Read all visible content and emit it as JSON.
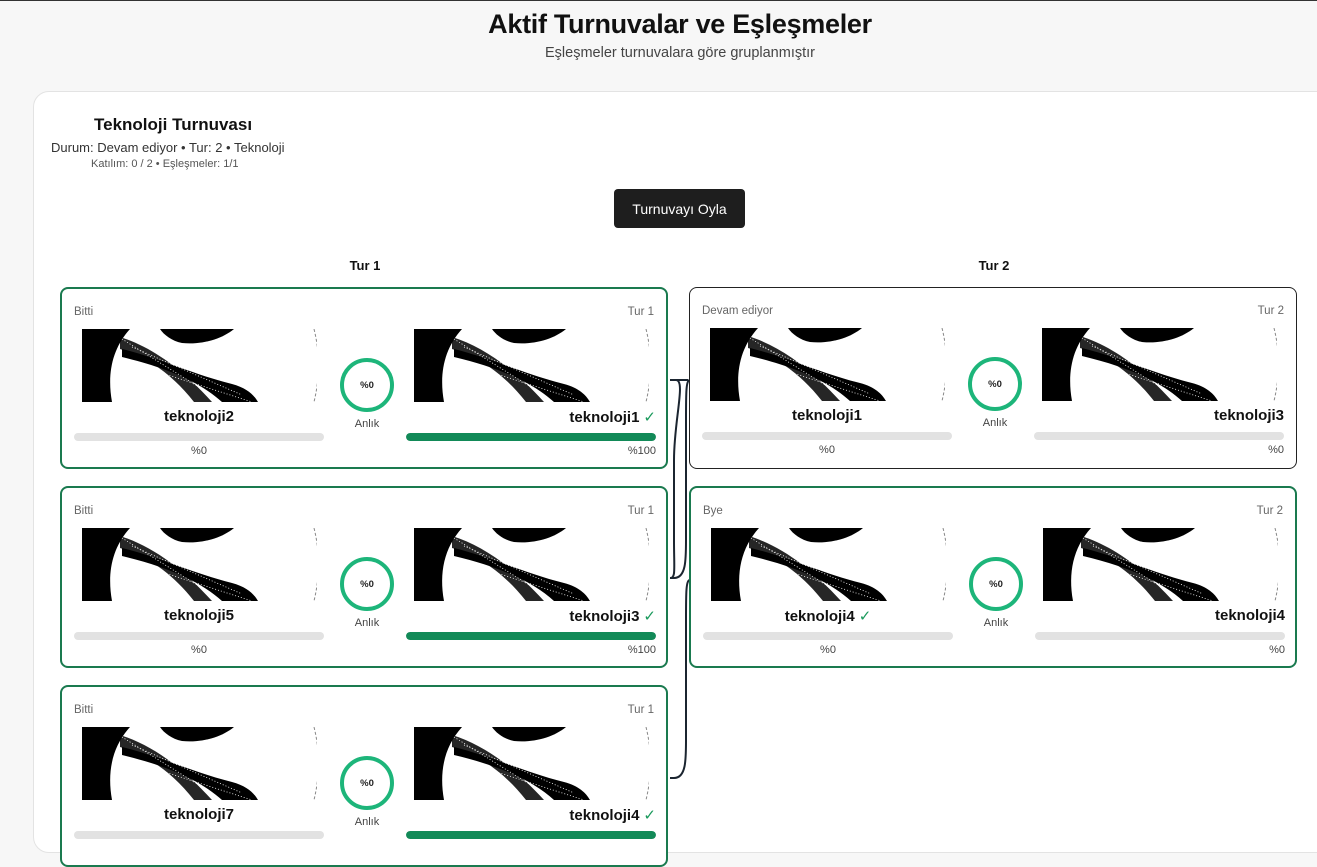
{
  "header": {
    "title": "Aktif Turnuvalar ve Eşleşmeler",
    "subtitle": "Eşleşmeler turnuvalara göre gruplanmıştır"
  },
  "tournament": {
    "name": "Teknoloji Turnuvası",
    "meta": "Durum: Devam ediyor • Tur: 2 • Teknoloji",
    "stats": "Katılım: 0 / 2 • Eşleşmeler: 1/1",
    "vote_button": "Turnuvayı Oyla"
  },
  "rounds": [
    {
      "label": "Tur 1",
      "matches": [
        {
          "status": "Bitti",
          "round": "Tur 1",
          "gauge": "%0",
          "gauge_label": "Anlık",
          "left": {
            "name": "teknoloji2",
            "pct": "%0",
            "fill": 0,
            "winner": false
          },
          "right": {
            "name": "teknoloji1",
            "pct": "%100",
            "fill": 1,
            "winner": true
          }
        },
        {
          "status": "Bitti",
          "round": "Tur 1",
          "gauge": "%0",
          "gauge_label": "Anlık",
          "left": {
            "name": "teknoloji5",
            "pct": "%0",
            "fill": 0,
            "winner": false
          },
          "right": {
            "name": "teknoloji3",
            "pct": "%100",
            "fill": 1,
            "winner": true
          }
        },
        {
          "status": "Bitti",
          "round": "Tur 1",
          "gauge": "%0",
          "gauge_label": "Anlık",
          "left": {
            "name": "teknoloji7",
            "pct": "",
            "fill": 0,
            "winner": false
          },
          "right": {
            "name": "teknoloji4",
            "pct": "",
            "fill": 1,
            "winner": true
          }
        }
      ]
    },
    {
      "label": "Tur 2",
      "matches": [
        {
          "status": "Devam ediyor",
          "round": "Tur 2",
          "gauge": "%0",
          "gauge_label": "Anlık",
          "left": {
            "name": "teknoloji1",
            "pct": "%0",
            "fill": 0,
            "winner": false
          },
          "right": {
            "name": "teknoloji3",
            "pct": "%0",
            "fill": 0,
            "winner": false
          }
        },
        {
          "status": "Bye",
          "round": "Tur 2",
          "gauge": "%0",
          "gauge_label": "Anlık",
          "left": {
            "name": "teknoloji4",
            "pct": "%0",
            "fill": 0,
            "winner": true
          },
          "right": {
            "name": "teknoloji4",
            "pct": "%0",
            "fill": 0,
            "winner": false
          }
        }
      ]
    }
  ],
  "check_mark": "✓",
  "colors": {
    "winner": "#1a7a4f",
    "gauge": "#1db57a",
    "bar_fill": "#128a58",
    "button": "#1e1e1e"
  }
}
